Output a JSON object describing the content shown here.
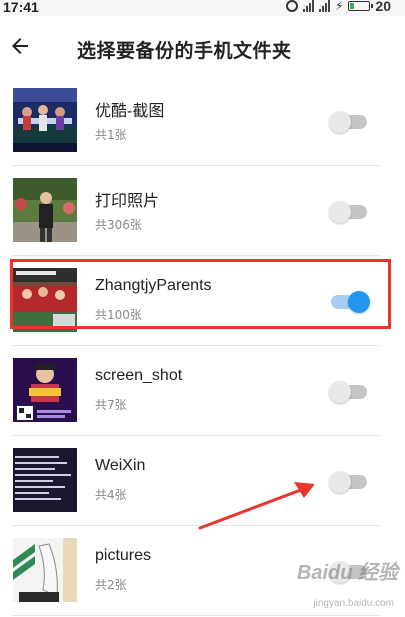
{
  "status_bar": {
    "time": "17:41",
    "battery_level": "20",
    "icons": [
      "alarm-icon",
      "signal-icon",
      "signal-icon",
      "charging-icon",
      "battery-icon"
    ]
  },
  "header": {
    "back_icon": "back-arrow-icon",
    "title": "选择要备份的手机文件夹"
  },
  "folders": [
    {
      "name": "优酷-截图",
      "count": "共1张",
      "enabled": false
    },
    {
      "name": "打印照片",
      "count": "共306张",
      "enabled": false
    },
    {
      "name": "ZhangtjyParents",
      "count": "共100张",
      "enabled": true
    },
    {
      "name": "screen_shot",
      "count": "共7张",
      "enabled": false
    },
    {
      "name": "WeiXin",
      "count": "共4张",
      "enabled": false
    },
    {
      "name": "pictures",
      "count": "共2张",
      "enabled": false
    }
  ],
  "colors": {
    "toggle_on": "#2196f3",
    "toggle_on_track": "#a7cdf4",
    "toggle_off_track": "#c5c5c5",
    "annotation_red": "#e8362c"
  },
  "watermark": {
    "brand": "Baidu 经验",
    "url": "jingyan.baidu.com"
  }
}
